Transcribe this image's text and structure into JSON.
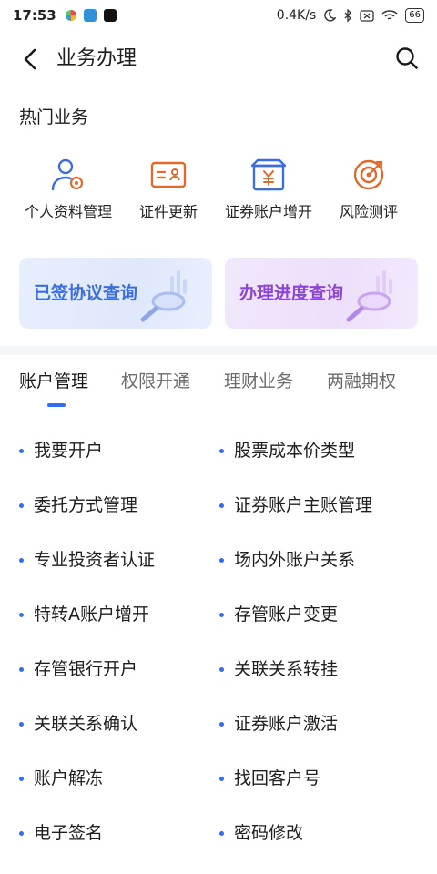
{
  "status_bar": {
    "time": "17:53",
    "network_speed": "0.4K/s",
    "battery": "66"
  },
  "header": {
    "title": "业务办理",
    "back_icon": "chevron-left-icon",
    "search_icon": "search-icon"
  },
  "hot": {
    "title": "热门业务",
    "items": [
      {
        "label": "个人资料管理",
        "icon": "user-settings-icon",
        "color": "#3a6ee0"
      },
      {
        "label": "证件更新",
        "icon": "id-card-icon",
        "color": "#e06a2c"
      },
      {
        "label": "证券账户增开",
        "icon": "yen-box-icon",
        "color": "#3a6ee0"
      },
      {
        "label": "风险测评",
        "icon": "target-icon",
        "color": "#e06a2c"
      }
    ]
  },
  "cards": {
    "signed": "已签协议查询",
    "progress": "办理进度查询"
  },
  "tabs": {
    "items": [
      "账户管理",
      "权限开通",
      "理财业务",
      "两融期权"
    ],
    "active": "账户管理"
  },
  "list": {
    "left": [
      "我要开户",
      "委托方式管理",
      "专业投资者认证",
      "特转A账户增开",
      "存管银行开户",
      "关联关系确认",
      "账户解冻",
      "电子签名"
    ],
    "right": [
      "股票成本价类型",
      "证券账户主账管理",
      "场内外账户关系",
      "存管账户变更",
      "关联关系转挂",
      "证券账户激活",
      "找回客户号",
      "密码修改"
    ]
  },
  "colors": {
    "accent": "#2f6df5",
    "blue_card_text": "#3a6ee0",
    "purple_card_text": "#8c44d6"
  }
}
